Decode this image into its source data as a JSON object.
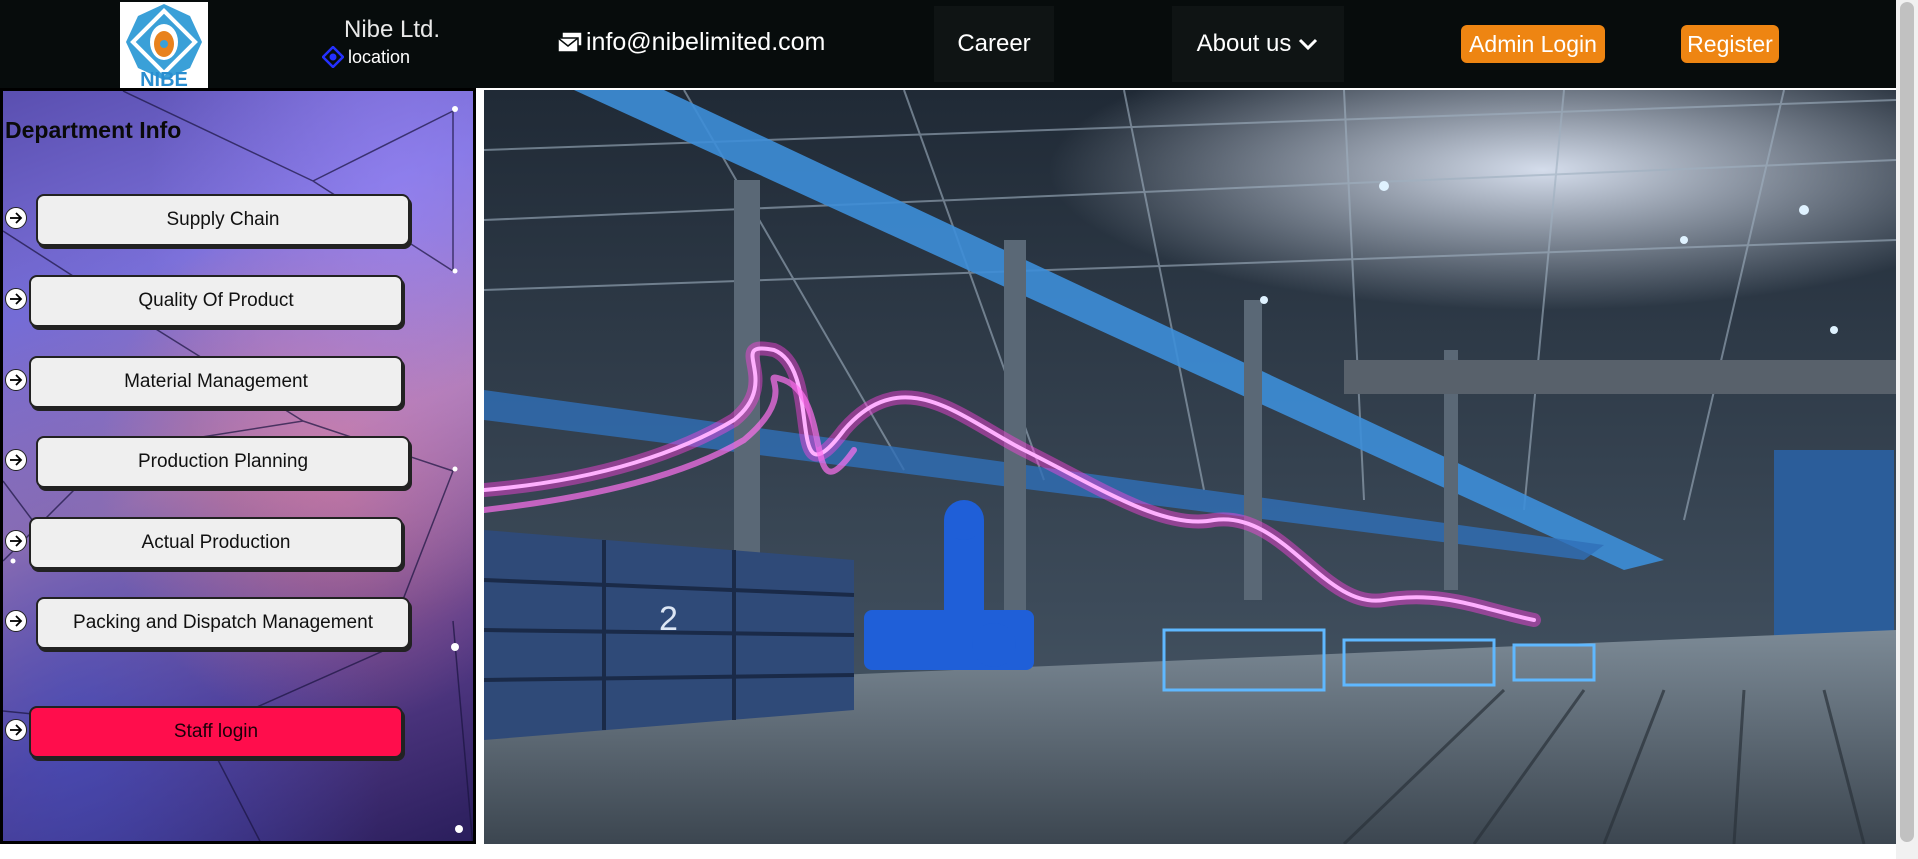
{
  "header": {
    "logo_text": "NIBE",
    "company_name": "Nibe Ltd.",
    "location_label": "location",
    "email": "info@nibelimited.com",
    "nav": {
      "career": "Career",
      "about": "About us"
    },
    "admin_login": "Admin Login",
    "register": "Register"
  },
  "sidebar": {
    "title": "Department Info",
    "items": [
      {
        "label": "Supply Chain"
      },
      {
        "label": "Quality Of Product"
      },
      {
        "label": "Material Management"
      },
      {
        "label": "Production Planning"
      },
      {
        "label": "Actual Production"
      },
      {
        "label": "Packing and Dispatch Management"
      }
    ],
    "staff_login": "Staff login"
  },
  "hero": {
    "crate_number": "2"
  },
  "colors": {
    "topbar": "#070c0c",
    "accent_orange": "#ee8512",
    "staff_pink": "#ff0d4c",
    "location_icon": "#2430ff",
    "light_trail": "#ff40e0"
  },
  "icons": [
    "email-icon",
    "location-icon",
    "chevron-down-icon",
    "arrow-right-icon"
  ]
}
